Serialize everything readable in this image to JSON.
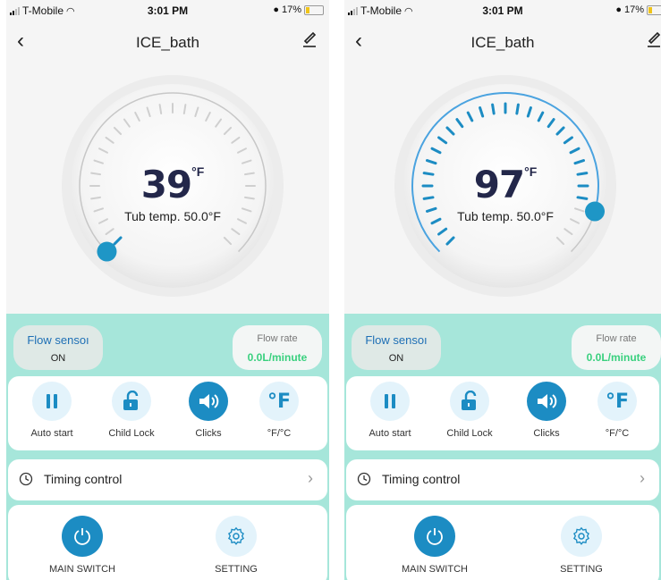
{
  "status": {
    "carrier": "T-Mobile",
    "time": "3:01 PM",
    "battery": "17%"
  },
  "nav": {
    "title": "ICE_bath"
  },
  "screens": [
    {
      "set_temp": "39",
      "unit": "°F",
      "tub_temp": "Tub temp. 50.0°F",
      "slider_value_f": 39
    },
    {
      "set_temp": "97",
      "unit": "°F",
      "tub_temp": "Tub temp. 50.0°F",
      "slider_value_f": 97
    }
  ],
  "flow_sensor": {
    "label": "Flow sensoı",
    "value": "ON"
  },
  "flow_rate": {
    "label": "Flow rate",
    "value": "0.0L/minute"
  },
  "controls": {
    "auto_start": "Auto start",
    "child_lock": "Child Lock",
    "clicks": "Clicks",
    "unit_toggle": "°F/°C"
  },
  "timing": {
    "label": "Timing control"
  },
  "bottom": {
    "main_switch": "MAIN SWITCH",
    "setting": "SETTING"
  },
  "colors": {
    "accent": "#1c8cc3",
    "teal_bg": "#a6e6da",
    "flow_green": "#39d07e",
    "dial_blue": "#4aa3e0"
  },
  "icons": [
    "back-arrow-icon",
    "edit-icon",
    "pause-icon",
    "unlock-icon",
    "speaker-icon",
    "fahrenheit-icon",
    "clock-icon",
    "chevron-right-icon",
    "power-icon",
    "gear-icon"
  ]
}
